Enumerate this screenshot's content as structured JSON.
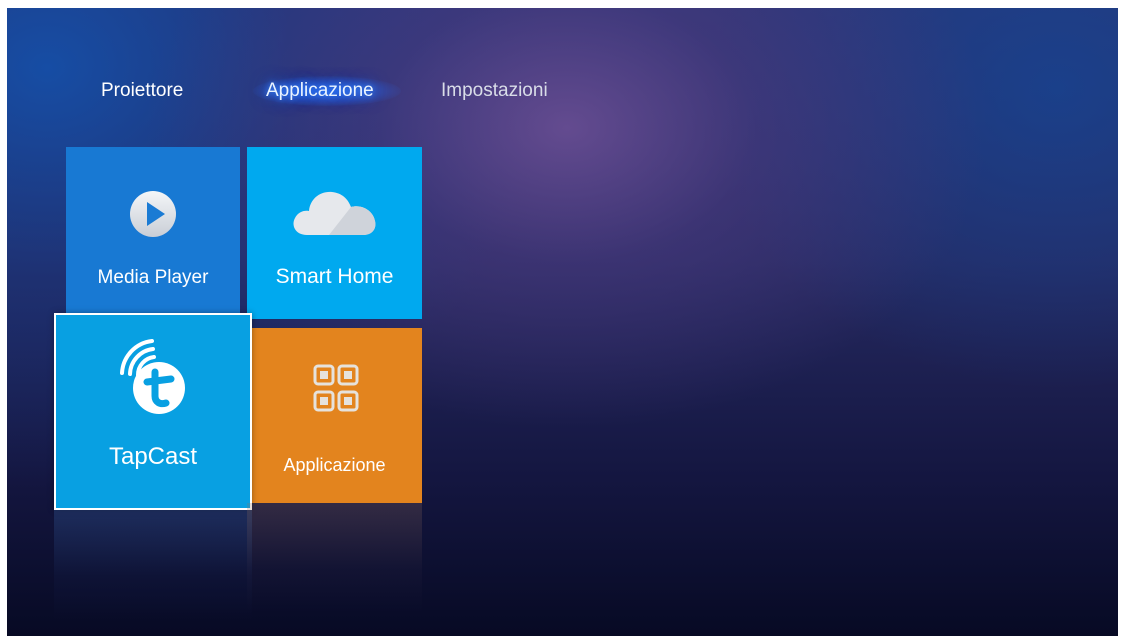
{
  "nav": {
    "tabs": [
      {
        "label": "Proiettore",
        "selected": false
      },
      {
        "label": "Applicazione",
        "selected": true
      },
      {
        "label": "Impostazioni",
        "selected": false
      }
    ]
  },
  "tiles": {
    "media_player": {
      "label": "Media Player",
      "icon": "play-icon",
      "color": "#1879d3"
    },
    "smart_home": {
      "label": "Smart Home",
      "icon": "cloud-icon",
      "color": "#00a9ef"
    },
    "tapcast": {
      "label": "TapCast",
      "icon": "tapcast-icon",
      "color": "#08a0e2",
      "focused": true
    },
    "applicazione": {
      "label": "Applicazione",
      "icon": "app-grid-icon",
      "color": "#e3841e"
    }
  },
  "colors": {
    "focus_border": "#ffffff",
    "selected_tab_glow": "#2a6cf0"
  }
}
